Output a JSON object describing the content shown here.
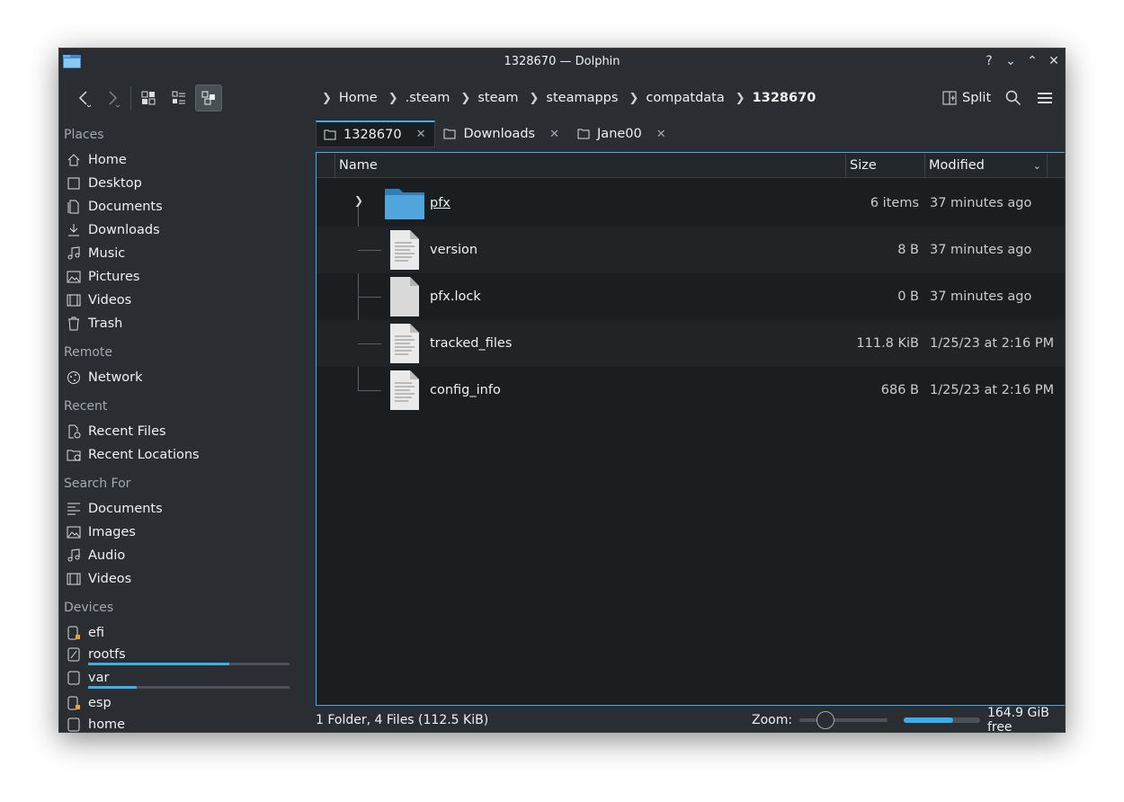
{
  "window": {
    "title": "1328670 — Dolphin"
  },
  "titlebar_controls": [
    "?",
    "⌄",
    "⌃",
    "✕"
  ],
  "breadcrumbs": [
    ".steam",
    "steam",
    "steamapps",
    "compatdata"
  ],
  "breadcrumb_home": "Home",
  "breadcrumb_current": "1328670",
  "toolbar": {
    "split_label": "Split"
  },
  "sidebar": {
    "places_header": "Places",
    "places": [
      {
        "label": "Home",
        "icon": "home-icon"
      },
      {
        "label": "Desktop",
        "icon": "desktop-icon"
      },
      {
        "label": "Documents",
        "icon": "documents-icon"
      },
      {
        "label": "Downloads",
        "icon": "downloads-icon"
      },
      {
        "label": "Music",
        "icon": "music-icon"
      },
      {
        "label": "Pictures",
        "icon": "pictures-icon"
      },
      {
        "label": "Videos",
        "icon": "videos-icon"
      },
      {
        "label": "Trash",
        "icon": "trash-icon"
      }
    ],
    "remote_header": "Remote",
    "remote": [
      {
        "label": "Network",
        "icon": "network-icon"
      }
    ],
    "recent_header": "Recent",
    "recent": [
      {
        "label": "Recent Files",
        "icon": "recent-files-icon"
      },
      {
        "label": "Recent Locations",
        "icon": "recent-locations-icon"
      }
    ],
    "search_header": "Search For",
    "search": [
      {
        "label": "Documents",
        "icon": "text-doc-icon"
      },
      {
        "label": "Images",
        "icon": "image-icon"
      },
      {
        "label": "Audio",
        "icon": "audio-icon"
      },
      {
        "label": "Videos",
        "icon": "video-icon"
      }
    ],
    "devices_header": "Devices",
    "devices": [
      {
        "label": "efi",
        "usage": null
      },
      {
        "label": "rootfs",
        "usage": 0.7
      },
      {
        "label": "var",
        "usage": 0.24
      },
      {
        "label": "esp",
        "usage": null
      },
      {
        "label": "home",
        "usage": null
      }
    ]
  },
  "tabs": [
    {
      "label": "1328670",
      "active": true
    },
    {
      "label": "Downloads",
      "active": false
    },
    {
      "label": "Jane00",
      "active": false
    }
  ],
  "columns": {
    "name": "Name",
    "size": "Size",
    "modified": "Modified"
  },
  "files": [
    {
      "name": "pfx",
      "size": "6 items",
      "modified": "37 minutes ago",
      "type": "folder"
    },
    {
      "name": "version",
      "size": "8 B",
      "modified": "37 minutes ago",
      "type": "text"
    },
    {
      "name": "pfx.lock",
      "size": "0 B",
      "modified": "37 minutes ago",
      "type": "blank"
    },
    {
      "name": "tracked_files",
      "size": "111.8 KiB",
      "modified": "1/25/23 at 2:16 PM",
      "type": "text"
    },
    {
      "name": "config_info",
      "size": "686 B",
      "modified": "1/25/23 at 2:16 PM",
      "type": "text"
    }
  ],
  "status": {
    "summary": "1 Folder, 4 Files (112.5 KiB)",
    "zoom_label": "Zoom:",
    "zoom_level": 0.2,
    "free_space": "164.9 GiB free",
    "used_fraction": 0.64
  },
  "colors": {
    "accent": "#3daee9",
    "background": "#1b1e20",
    "panel": "#2a2e32"
  }
}
